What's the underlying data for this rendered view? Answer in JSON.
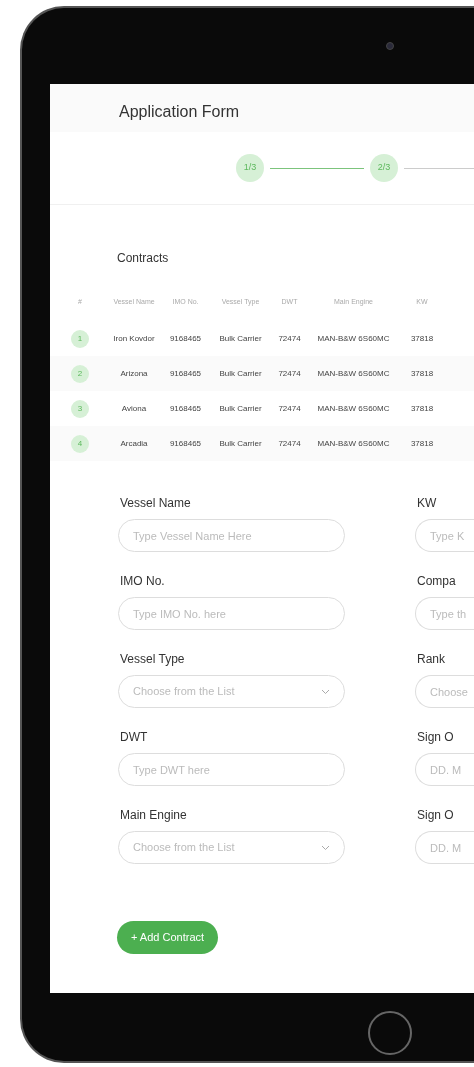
{
  "window": {
    "title": "Application Form"
  },
  "stepper": [
    {
      "label": "1/3",
      "completed": true
    },
    {
      "label": "2/3",
      "completed": false
    }
  ],
  "contracts": {
    "title": "Contracts",
    "number_header": "#",
    "columns": [
      "Vessel Name",
      "IMO No.",
      "Vessel Type",
      "DWT",
      "Main Engine",
      "KW"
    ],
    "rows": [
      {
        "number": "1",
        "cells": [
          "Iron Kovdor",
          "9168465",
          "Bulk Carrier",
          "72474",
          "MAN-B&W 6S60MC",
          "37818"
        ]
      },
      {
        "number": "2",
        "cells": [
          "Arizona",
          "9168465",
          "Bulk Carrier",
          "72474",
          "MAN-B&W 6S60MC",
          "37818"
        ]
      },
      {
        "number": "3",
        "cells": [
          "Aviona",
          "9168465",
          "Bulk Carrier",
          "72474",
          "MAN-B&W 6S60MC",
          "37818"
        ]
      },
      {
        "number": "4",
        "cells": [
          "Arcadia",
          "9168465",
          "Bulk Carrier",
          "72474",
          "MAN-B&W 6S60MC",
          "37818"
        ]
      }
    ]
  },
  "form": {
    "left": [
      {
        "label": "Vessel Name",
        "placeholder": "Type Vessel Name Here",
        "kind": "text"
      },
      {
        "label": "IMO No.",
        "placeholder": "Type IMO No. here",
        "kind": "text"
      },
      {
        "label": "Vessel Type",
        "placeholder": "Choose from the List",
        "kind": "select"
      },
      {
        "label": "DWT",
        "placeholder": "Type DWT here",
        "kind": "text"
      },
      {
        "label": "Main Engine",
        "placeholder": "Choose from the List",
        "kind": "select"
      }
    ],
    "right": [
      {
        "label": "KW",
        "placeholder": "Type K",
        "kind": "text"
      },
      {
        "label": "Compa",
        "placeholder": "Type th",
        "kind": "text"
      },
      {
        "label": "Rank",
        "placeholder": "Choose",
        "kind": "text"
      },
      {
        "label": "Sign O",
        "placeholder": "DD. M",
        "kind": "text"
      },
      {
        "label": "Sign O",
        "placeholder": "DD. M",
        "kind": "text"
      }
    ]
  },
  "add_button": "+ Add Contract"
}
